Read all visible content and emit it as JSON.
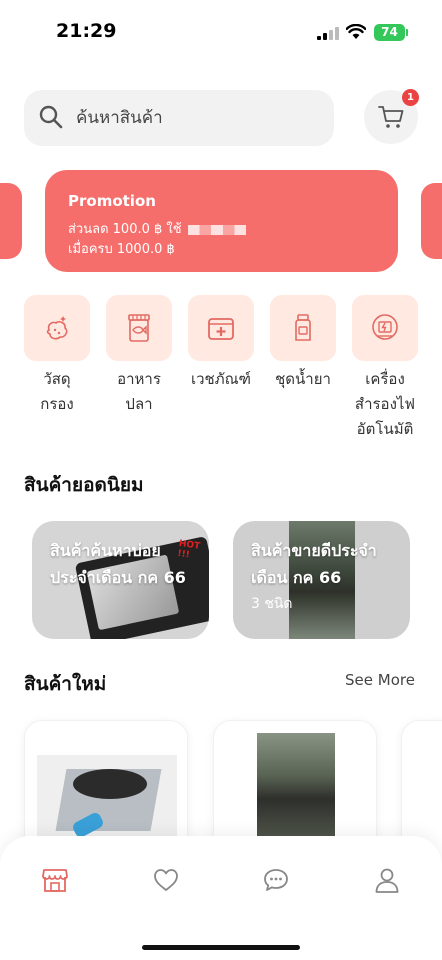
{
  "status": {
    "time": "21:29",
    "battery": "74"
  },
  "search": {
    "placeholder": "ค้นหาสินค้า"
  },
  "cart": {
    "badge": "1"
  },
  "promo": {
    "title": "Promotion",
    "line1": "ส่วนลด 100.0 ฿ ใช้",
    "line2": "เมื่อครบ 1000.0 ฿"
  },
  "categories": [
    {
      "label": "วัสดุ\nกรอง",
      "icon": "filter-media-icon"
    },
    {
      "label": "อาหาร\nปลา",
      "icon": "fish-food-icon"
    },
    {
      "label": "เวชภัณฑ์",
      "icon": "medicine-box-icon"
    },
    {
      "label": "ชุดน้ำยา",
      "icon": "test-kit-bottle-icon"
    },
    {
      "label": "เครื่อง\nสำรองไฟ\nอัตโนมัติ",
      "icon": "backup-power-icon"
    }
  ],
  "popular": {
    "title": "สินค้ายอดนิยม",
    "cards": [
      {
        "text": "สินค้าค้นหาบ่อยประจำเดือน กค 66",
        "hot": "HOT !!!"
      },
      {
        "text": "สินค้าขายดีประจำเดือน กค 66",
        "sub": "3 ชนิด"
      }
    ]
  },
  "new_products": {
    "title": "สินค้าใหม่",
    "see_more": "See More"
  },
  "bottom_nav": [
    "shop-icon",
    "heart-icon",
    "chat-icon",
    "profile-icon"
  ],
  "colors": {
    "accent": "#f56e6b",
    "category_bg": "#ffe9e1",
    "badge": "#e94343"
  }
}
